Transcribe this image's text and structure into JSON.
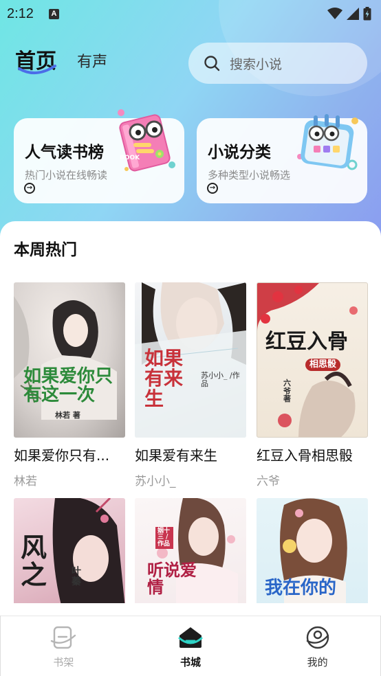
{
  "status": {
    "time": "2:12",
    "notification_badge": "A"
  },
  "header": {
    "tab_home": "首页",
    "tab_audio": "有声"
  },
  "search": {
    "placeholder": "搜索小说"
  },
  "cards": [
    {
      "title": "人气读书榜",
      "subtitle": "热门小说在线畅读",
      "art_text": "BOOK"
    },
    {
      "title": "小说分类",
      "subtitle": "多种类型小说畅选"
    }
  ],
  "section": {
    "title": "本周热门"
  },
  "books": [
    {
      "title": "如果爱你只有...",
      "author": "林若",
      "cover_title": "如果爱你只有这一次",
      "cover_author": "林若 著"
    },
    {
      "title": "如果爱有来生",
      "author": "苏小小_",
      "cover_title": "如果有来生",
      "cover_author": "苏小小_ /作品"
    },
    {
      "title": "红豆入骨相思骰",
      "author": "六爷",
      "cover_title": "红豆入骨",
      "cover_sub": "相思骰",
      "cover_author": "六爷 著"
    },
    {
      "cover_title": "风之",
      "cover_author": "叶蓁"
    },
    {
      "cover_title": "听说爱情",
      "cover_author": "姻十三 /作品"
    },
    {
      "cover_title": "我在你的"
    }
  ],
  "nav": [
    {
      "label": "书架",
      "icon": "bookshelf-icon"
    },
    {
      "label": "书城",
      "icon": "bookstore-icon"
    },
    {
      "label": "我的",
      "icon": "profile-icon"
    }
  ],
  "colors": {
    "accent": "#2fd3c6",
    "hero_start": "#6fe6e4",
    "hero_end": "#8a9cf0"
  }
}
